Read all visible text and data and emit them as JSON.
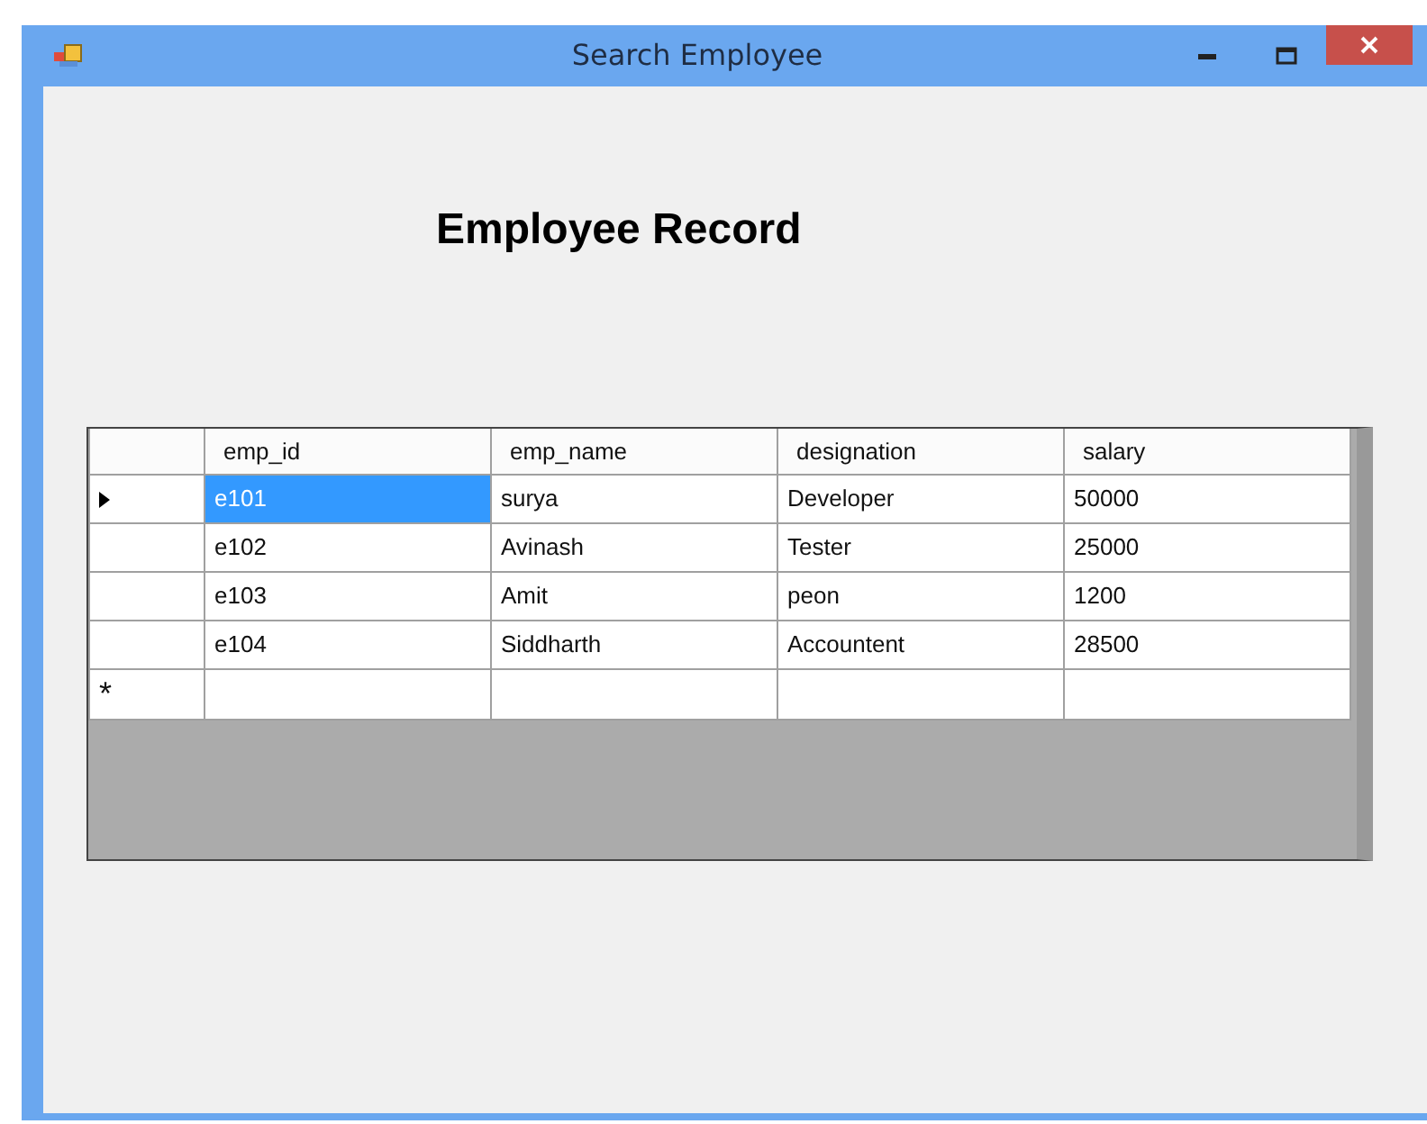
{
  "window": {
    "title": "Search Employee"
  },
  "heading": "Employee Record",
  "grid": {
    "columns": [
      "emp_id",
      "emp_name",
      "designation",
      "salary"
    ],
    "rows": [
      {
        "current": true,
        "cells": [
          {
            "text": "e101",
            "selected": true
          },
          {
            "text": "surya",
            "selected": false
          },
          {
            "text": "Developer",
            "selected": false
          },
          {
            "text": "50000",
            "selected": false
          }
        ]
      },
      {
        "current": false,
        "cells": [
          {
            "text": "e102",
            "selected": false
          },
          {
            "text": "Avinash",
            "selected": false
          },
          {
            "text": "Tester",
            "selected": false
          },
          {
            "text": "25000",
            "selected": false
          }
        ]
      },
      {
        "current": false,
        "cells": [
          {
            "text": "e103",
            "selected": false
          },
          {
            "text": "Amit",
            "selected": false
          },
          {
            "text": "peon",
            "selected": false
          },
          {
            "text": "1200",
            "selected": false
          }
        ]
      },
      {
        "current": false,
        "cells": [
          {
            "text": "e104",
            "selected": false
          },
          {
            "text": "Siddharth",
            "selected": false
          },
          {
            "text": "Accountent",
            "selected": false
          },
          {
            "text": "28500",
            "selected": false
          }
        ]
      }
    ],
    "new_row": {
      "marker": "*"
    }
  }
}
